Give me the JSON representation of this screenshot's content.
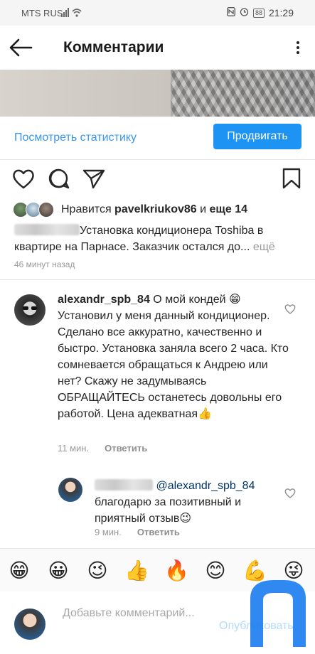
{
  "status_bar": {
    "carrier": "MTS RUS",
    "battery": "88",
    "time": "21:29"
  },
  "header": {
    "title": "Комментарии"
  },
  "post": {
    "stats_link": "Посмотреть статистику",
    "promote_label": "Продвигать",
    "likes_prefix": "Нравится ",
    "likes_user": "pavelkriukov86",
    "likes_middle": " и ",
    "likes_more": "еще 14",
    "caption_text": "Установка кондиционера Toshiba в квартире на Парнасе. Заказчик остался  до...",
    "caption_more": " ещё",
    "time": "46 минут назад"
  },
  "comments": [
    {
      "username": "alexandr_spb_84",
      "text": " О мой кондей 😁 Установил у меня данный кондиционер. Сделано все аккуратно, качественно и быстро. Установка заняла всего 2 часа. Кто сомневается обращаться к Андрею или нет? Скажу не задумываясь ОБРАЩАЙТЕСЬ останетесь довольны его работой. Цена адекватная👍",
      "time": "11 мин.",
      "reply_label": "Ответить"
    },
    {
      "mention": "@alexandr_spb_84",
      "text": "благодарю за позитивный и приятный отзыв😉",
      "time": "9 мин.",
      "reply_label": "Ответить"
    }
  ],
  "emoji_bar": [
    "😁",
    "😀",
    "😉",
    "👍",
    "🔥",
    "😊",
    "💪",
    "😜"
  ],
  "input": {
    "placeholder": "Добавьте комментарий...",
    "publish_label": "Опубликовать"
  },
  "colors": {
    "accent": "#3897f0",
    "promote_bg": "#1d93f4",
    "muted": "#999999",
    "watermark": "#1a7cf0"
  }
}
